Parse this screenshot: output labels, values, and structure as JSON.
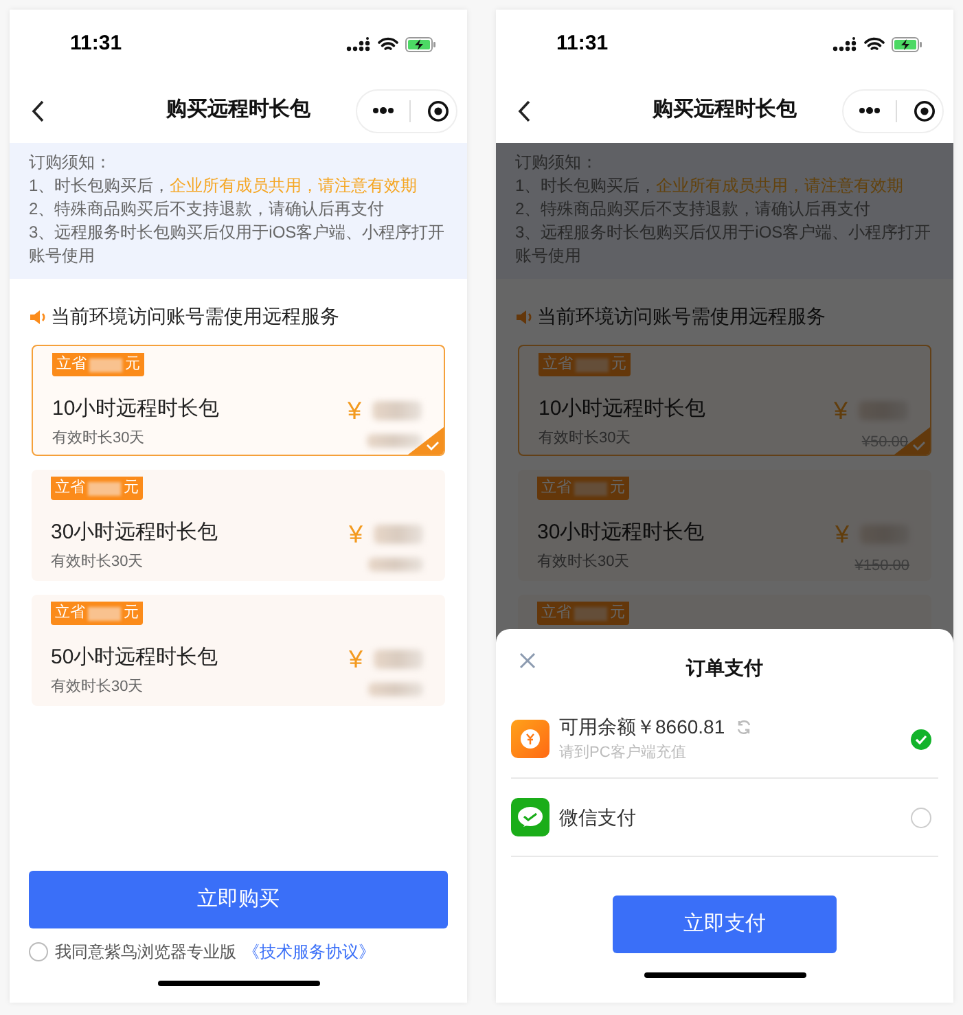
{
  "phones": [
    {
      "status_bar": {
        "time": "11:31"
      },
      "nav": {
        "title": "购买远程时长包"
      },
      "notice": {
        "heading": "订购须知：",
        "lines": [
          {
            "text": "1、时长包购买后，",
            "highlight": "企业所有成员共用，请注意有效期"
          },
          {
            "text": "2、特殊商品购买后不支持退款，请确认后再支付"
          },
          {
            "text": "3、远程服务时长包购买后仅用于iOS客户端、小程序打开账号使用"
          }
        ]
      },
      "section_title": "当前环境访问账号需使用远程服务",
      "plans": [
        {
          "tag_prefix": "立省",
          "tag_suffix": "元",
          "title": "10小时远程时长包",
          "validity": "有效时长30天",
          "currency": "¥",
          "selected": true
        },
        {
          "tag_prefix": "立省",
          "tag_suffix": "元",
          "title": "30小时远程时长包",
          "validity": "有效时长30天",
          "currency": "¥",
          "selected": false
        },
        {
          "tag_prefix": "立省",
          "tag_suffix": "元",
          "title": "50小时远程时长包",
          "validity": "有效时长30天",
          "currency": "¥",
          "selected": false
        }
      ],
      "buy_button": "立即购买",
      "agreement": {
        "text": "我同意紫鸟浏览器专业版",
        "link": "《技术服务协议》",
        "checked": false
      }
    },
    {
      "status_bar": {
        "time": "11:31"
      },
      "nav": {
        "title": "购买远程时长包"
      },
      "notice": {
        "heading": "订购须知：",
        "lines": [
          {
            "text": "1、时长包购买后，",
            "highlight": "企业所有成员共用，请注意有效期"
          },
          {
            "text": "2、特殊商品购买后不支持退款，请确认后再支付"
          },
          {
            "text": "3、远程服务时长包购买后仅用于iOS客户端、小程序打开账号使用"
          }
        ]
      },
      "section_title": "当前环境访问账号需使用远程服务",
      "plans": [
        {
          "tag_prefix": "立省",
          "tag_suffix": "元",
          "title": "10小时远程时长包",
          "validity": "有效时长30天",
          "currency": "¥",
          "original_price": "¥50.00",
          "selected": true
        },
        {
          "tag_prefix": "立省",
          "tag_suffix": "元",
          "title": "30小时远程时长包",
          "validity": "有效时长30天",
          "currency": "¥",
          "original_price": "¥150.00",
          "selected": false
        },
        {
          "tag_prefix": "立省",
          "tag_suffix": "元",
          "selected": false
        }
      ],
      "payment_sheet": {
        "title": "订单支付",
        "methods": [
          {
            "kind": "balance",
            "label": "可用余额￥8660.81",
            "hint": "请到PC客户端充值",
            "selected": true
          },
          {
            "kind": "wechat",
            "label": "微信支付",
            "selected": false
          }
        ],
        "pay_button": "立即支付"
      }
    }
  ]
}
